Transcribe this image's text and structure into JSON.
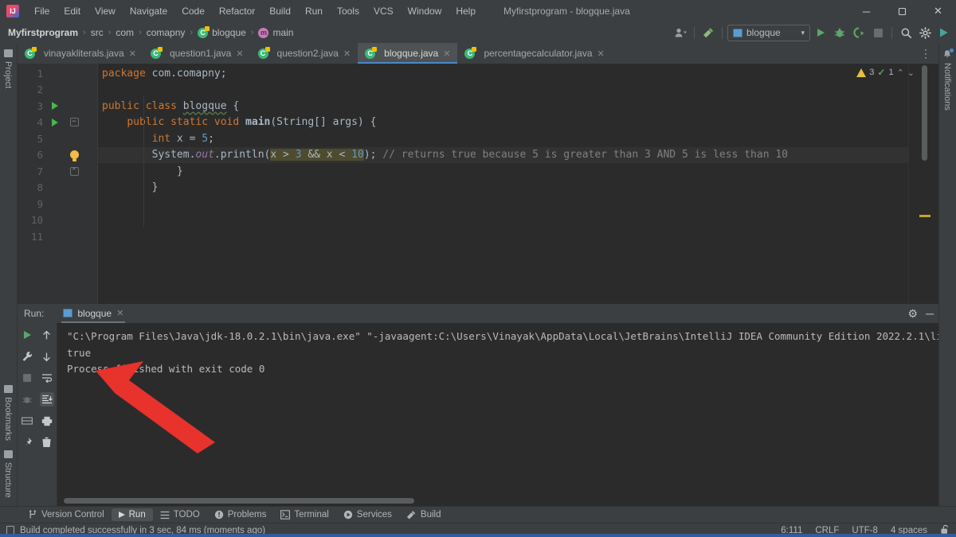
{
  "window": {
    "title": "Myfirstprogram - blogque.java",
    "logo_text": "IJ",
    "minimize": "─",
    "maximize": "❐",
    "close": "✕"
  },
  "menu": [
    "File",
    "Edit",
    "View",
    "Navigate",
    "Code",
    "Refactor",
    "Build",
    "Run",
    "Tools",
    "VCS",
    "Window",
    "Help"
  ],
  "breadcrumb": {
    "project": "Myfirstprogram",
    "items": [
      "src",
      "com",
      "comapny"
    ],
    "class": "blogque",
    "class_icon": "C",
    "method": "main",
    "method_icon": "m",
    "separator": "›"
  },
  "toolbar": {
    "user_icon": "person-icon",
    "build_icon": "hammer-icon",
    "run_config": "blogque",
    "dropdown_caret": "▾",
    "run_icon": "run-icon",
    "debug_icon": "debug-icon",
    "coverage_icon": "run-with-coverage-icon",
    "stop_icon": "stop-icon",
    "search_icon": "⌕",
    "settings_icon": "⚙",
    "updates_icon": "ide-updates-icon"
  },
  "rails": {
    "left_top": [
      "Project"
    ],
    "left_bottom": [
      "Bookmarks",
      "Structure"
    ],
    "right_top": [
      "Notifications"
    ]
  },
  "tabs": [
    {
      "label": "vinayakliterals.java",
      "active": false
    },
    {
      "label": "question1.java",
      "active": false
    },
    {
      "label": "question2.java",
      "active": false
    },
    {
      "label": "blogque.java",
      "active": true
    },
    {
      "label": "percentagecalculator.java",
      "active": false
    }
  ],
  "tab_close": "✕",
  "tabs_more": "⋮",
  "editor": {
    "line_numbers": [
      "1",
      "2",
      "3",
      "4",
      "5",
      "6",
      "7",
      "8",
      "9",
      "10",
      "11"
    ],
    "lines": [
      {
        "n": 1,
        "text": "package com.comapny;"
      },
      {
        "n": 2,
        "text": ""
      },
      {
        "n": 3,
        "text": "public class blogque {"
      },
      {
        "n": 4,
        "text": "    public static void main(String[] args) {"
      },
      {
        "n": 5,
        "text": "        int x = 5;"
      },
      {
        "n": 6,
        "text": "        System.out.println(x > 3 && x < 10); // returns true because 5 is greater than 3 AND 5 is less than 10"
      },
      {
        "n": 7,
        "text": "            }"
      },
      {
        "n": 8,
        "text": "        }"
      },
      {
        "n": 9,
        "text": ""
      },
      {
        "n": 10,
        "text": ""
      },
      {
        "n": 11,
        "text": ""
      }
    ],
    "tokens": {
      "kw_package": "package",
      "pkg_name": " com.comapny;",
      "kw_public": "public",
      "kw_class": "class",
      "class_name": "blogque",
      "brace_open": "{",
      "kw_static": "static",
      "kw_void": "void",
      "method_main": "main",
      "main_params": "(String[] args) {",
      "kw_int": "int",
      "var_decl": " x = ",
      "val_5": "5",
      "semi": ";",
      "system": "System.",
      "out": "out",
      "println": ".println(",
      "cond_a": "x > ",
      "num_3": "3",
      "cond_and": " && x < ",
      "num_10": "10",
      "close_paren": ");",
      "comment": " // returns true because 5 is greater than 3 AND 5 is less than 10",
      "brace_close_inner": "}",
      "brace_close_outer": "}"
    },
    "inspection": {
      "warning_count": "3",
      "weak_count": "1",
      "chevron_up": "⌃",
      "chevron_down": "⌄"
    },
    "fold_collapse": "−",
    "fold_expand": "⌃"
  },
  "run_window": {
    "label": "Run:",
    "tab_name": "blogque",
    "tab_close": "✕",
    "settings_icon": "⚙",
    "minimize_icon": "─",
    "left_icons": [
      "rerun-icon",
      "wrench-icon",
      "stop-icon",
      "debug-icon",
      "layout-icon",
      "pin-icon"
    ],
    "right_icons": [
      "up-arrow-icon",
      "down-arrow-icon",
      "soft-wrap-icon",
      "scroll-to-end-icon",
      "print-icon",
      "trash-icon"
    ],
    "console": [
      "\"C:\\Program Files\\Java\\jdk-18.0.2.1\\bin\\java.exe\" \"-javaagent:C:\\Users\\Vinayak\\AppData\\Local\\JetBrains\\IntelliJ IDEA Community Edition 2022.2.1\\li",
      "true",
      "",
      "Process finished with exit code 0"
    ]
  },
  "bottom_bar": [
    {
      "label": "Version Control",
      "icon": "branch-icon",
      "active": false
    },
    {
      "label": "Run",
      "icon": "run-icon",
      "active": true
    },
    {
      "label": "TODO",
      "icon": "list-icon",
      "active": false
    },
    {
      "label": "Problems",
      "icon": "problems-icon",
      "active": false
    },
    {
      "label": "Terminal",
      "icon": "terminal-icon",
      "active": false
    },
    {
      "label": "Services",
      "icon": "services-icon",
      "active": false
    },
    {
      "label": "Build",
      "icon": "hammer-icon",
      "active": false
    }
  ],
  "status_bar": {
    "message": "Build completed successfully in 3 sec, 84 ms (moments ago)",
    "caret": "6:111",
    "line_separator": "CRLF",
    "encoding": "UTF-8",
    "indent": "4 spaces",
    "lock_icon": "unlocked-icon"
  },
  "annotation": {
    "type": "arrow",
    "color": "#e8322c",
    "points_to": "true"
  },
  "colors": {
    "accent_blue": "#4a88c7",
    "editor_bg": "#2b2b2b",
    "chrome_bg": "#3c3f41",
    "run_green": "#59a869",
    "warning_yellow": "#e8bf3c",
    "annotation_red": "#e8322c",
    "status_blue": "#2f5d9e"
  }
}
